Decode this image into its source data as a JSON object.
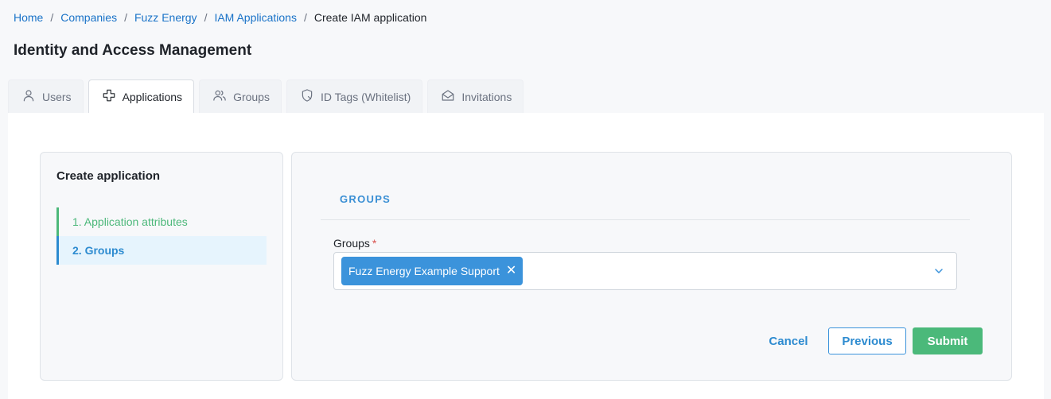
{
  "breadcrumb": {
    "items": [
      "Home",
      "Companies",
      "Fuzz Energy",
      "IAM Applications"
    ],
    "current": "Create IAM application",
    "separator": "/"
  },
  "page": {
    "title": "Identity and Access Management"
  },
  "tabs": [
    {
      "label": "Users",
      "icon": "user-icon",
      "active": false
    },
    {
      "label": "Applications",
      "icon": "applications-icon",
      "active": true
    },
    {
      "label": "Groups",
      "icon": "groups-icon",
      "active": false
    },
    {
      "label": "ID Tags (Whitelist)",
      "icon": "id-tag-icon",
      "active": false
    },
    {
      "label": "Invitations",
      "icon": "envelope-icon",
      "active": false
    }
  ],
  "steps": {
    "title": "Create application",
    "items": [
      {
        "label": "1. Application attributes",
        "state": "done"
      },
      {
        "label": "2. Groups",
        "state": "active"
      }
    ]
  },
  "form": {
    "section_title": "GROUPS",
    "groups_field": {
      "label": "Groups",
      "required_marker": "*",
      "selected": [
        "Fuzz Energy Example Support"
      ],
      "remove_glyph": "✕"
    }
  },
  "actions": {
    "cancel_label": "Cancel",
    "previous_label": "Previous",
    "submit_label": "Submit"
  },
  "colors": {
    "accent_blue": "#3b93db",
    "link_blue": "#1a73c8",
    "success_green": "#4bb97a",
    "required_red": "#d9534f"
  }
}
